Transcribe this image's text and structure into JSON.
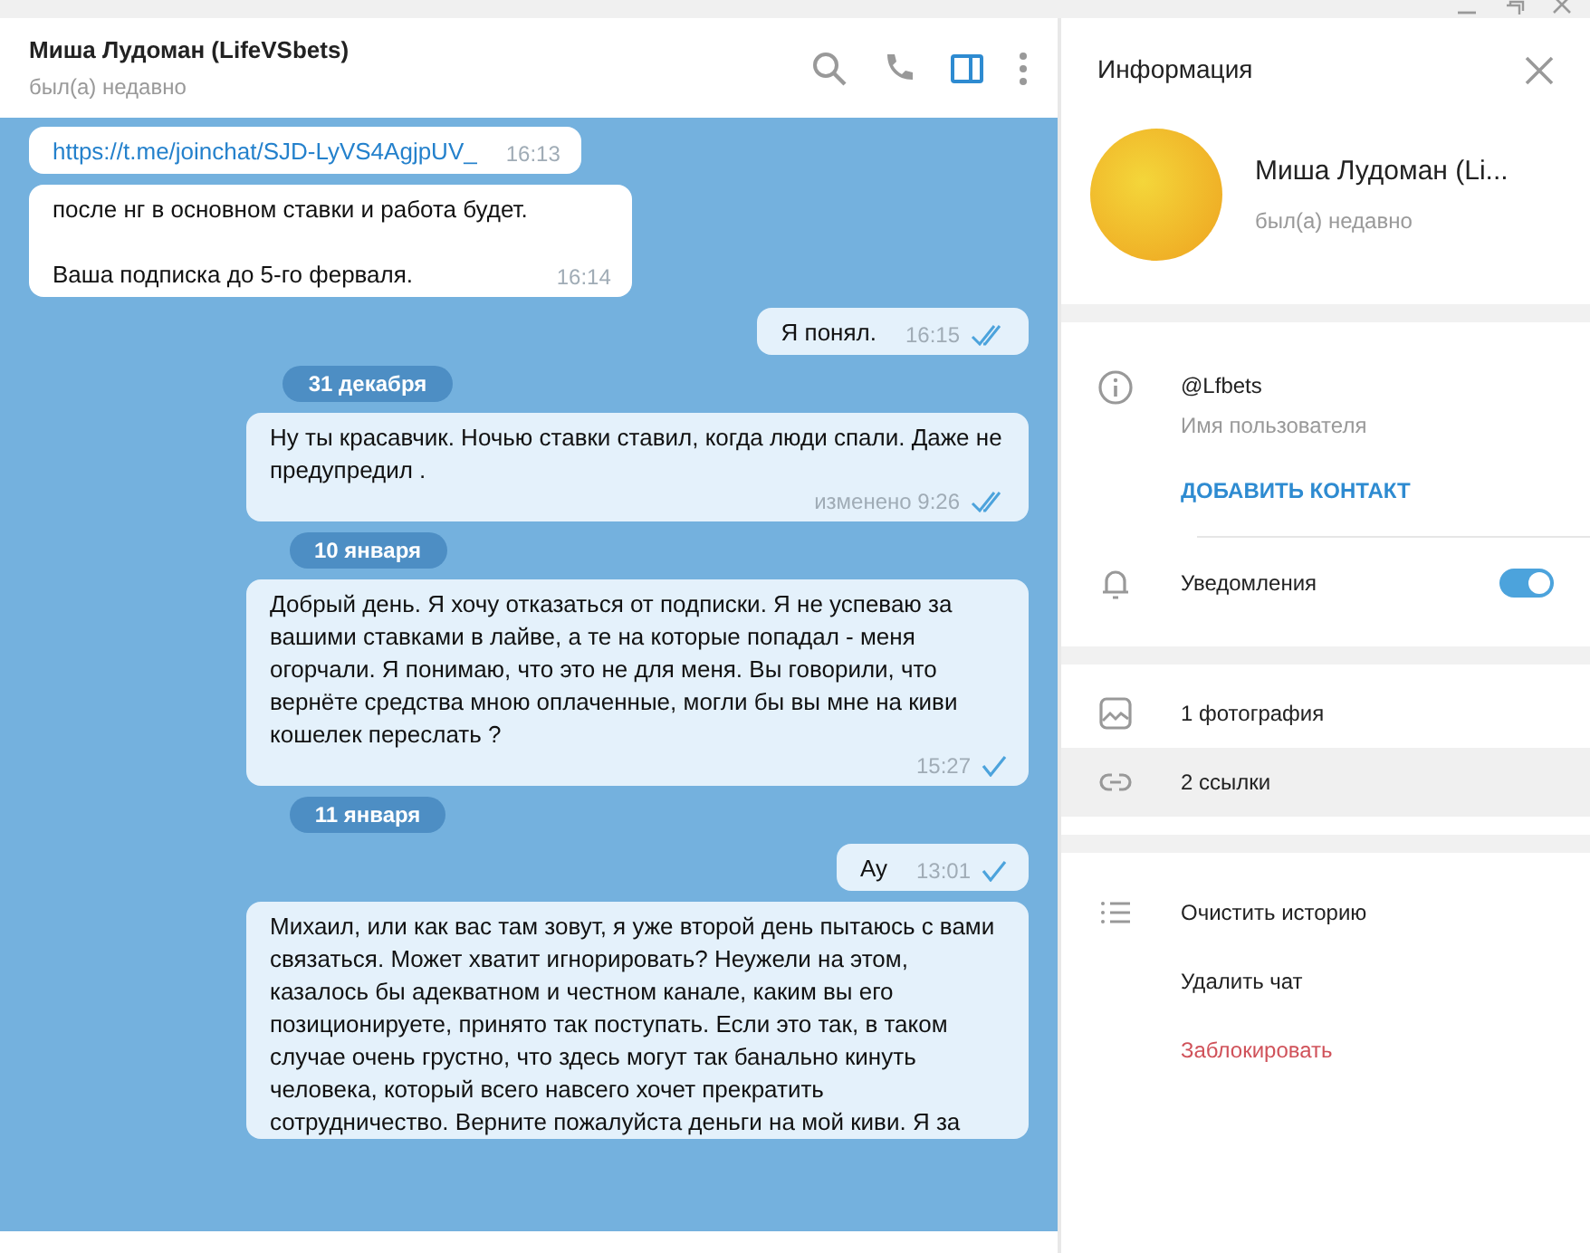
{
  "chat_header": {
    "title": "Миша Лудоман (LifeVSbets)",
    "status": "был(а) недавно",
    "sidebar_toggle_on": true
  },
  "messages": [
    {
      "kind": "in",
      "text": "https://t.me/joinchat/SJD-LyVS4AgjpUV_",
      "link": true,
      "time": "16:13"
    },
    {
      "kind": "in",
      "text": "после нг в основном ставки и работа будет.\n\nВаша подписка до 5-го ферваля.",
      "link": false,
      "time": "16:14"
    },
    {
      "kind": "out",
      "text": "Я понял.",
      "time": "16:15",
      "read": true
    },
    {
      "kind": "date",
      "text": "31 декабря"
    },
    {
      "kind": "out",
      "text": "Ну ты красавчик. Ночью ставки ставил, когда люди спали. Даже не предупредил .",
      "time": "изменено 9:26",
      "read": true
    },
    {
      "kind": "date",
      "text": "10 января"
    },
    {
      "kind": "out",
      "text": "Добрый день. Я хочу отказаться от подписки. Я не успеваю за вашими ставками в лайве, а те на которые попадал - меня огорчали. Я понимаю, что это не для меня. Вы говорили, что вернёте средства мною оплаченные, могли бы вы мне на киви кошелек переслать ?",
      "time": "15:27",
      "read": false
    },
    {
      "kind": "date",
      "text": "11 января"
    },
    {
      "kind": "out",
      "text": "Ау",
      "time": "13:01",
      "read": false
    },
    {
      "kind": "out",
      "text": "Михаил, или как вас там зовут, я уже второй день пытаюсь с вами связаться. Может хватит игнорировать? Неужели на этом, казалось бы адекватном и честном канале, каким вы его позиционируете, принято так поступать. Если это так, в таком случае очень грустно, что здесь могут так банально кинуть человека, который всего навсего хочет прекратить сотрудничество. Верните пожалуйста деньги на мой киви. Я за"
    }
  ],
  "info_panel": {
    "title": "Информация",
    "name": "Миша Лудоман (Li...",
    "status": "был(а) недавно",
    "username": "@Lfbets",
    "username_label": "Имя пользователя",
    "add_contact": "ДОБАВИТЬ КОНТАКТ",
    "notifications": {
      "label": "Уведомления",
      "on": true
    },
    "media": [
      {
        "kind": "photo",
        "label": "1 фотография",
        "highlighted": false
      },
      {
        "kind": "link",
        "label": "2 ссылки",
        "highlighted": true
      }
    ],
    "actions": [
      {
        "kind": "clear",
        "label": "Очистить историю"
      },
      {
        "kind": "delete",
        "label": "Удалить чат"
      },
      {
        "kind": "block",
        "label": "Заблокировать"
      }
    ]
  }
}
